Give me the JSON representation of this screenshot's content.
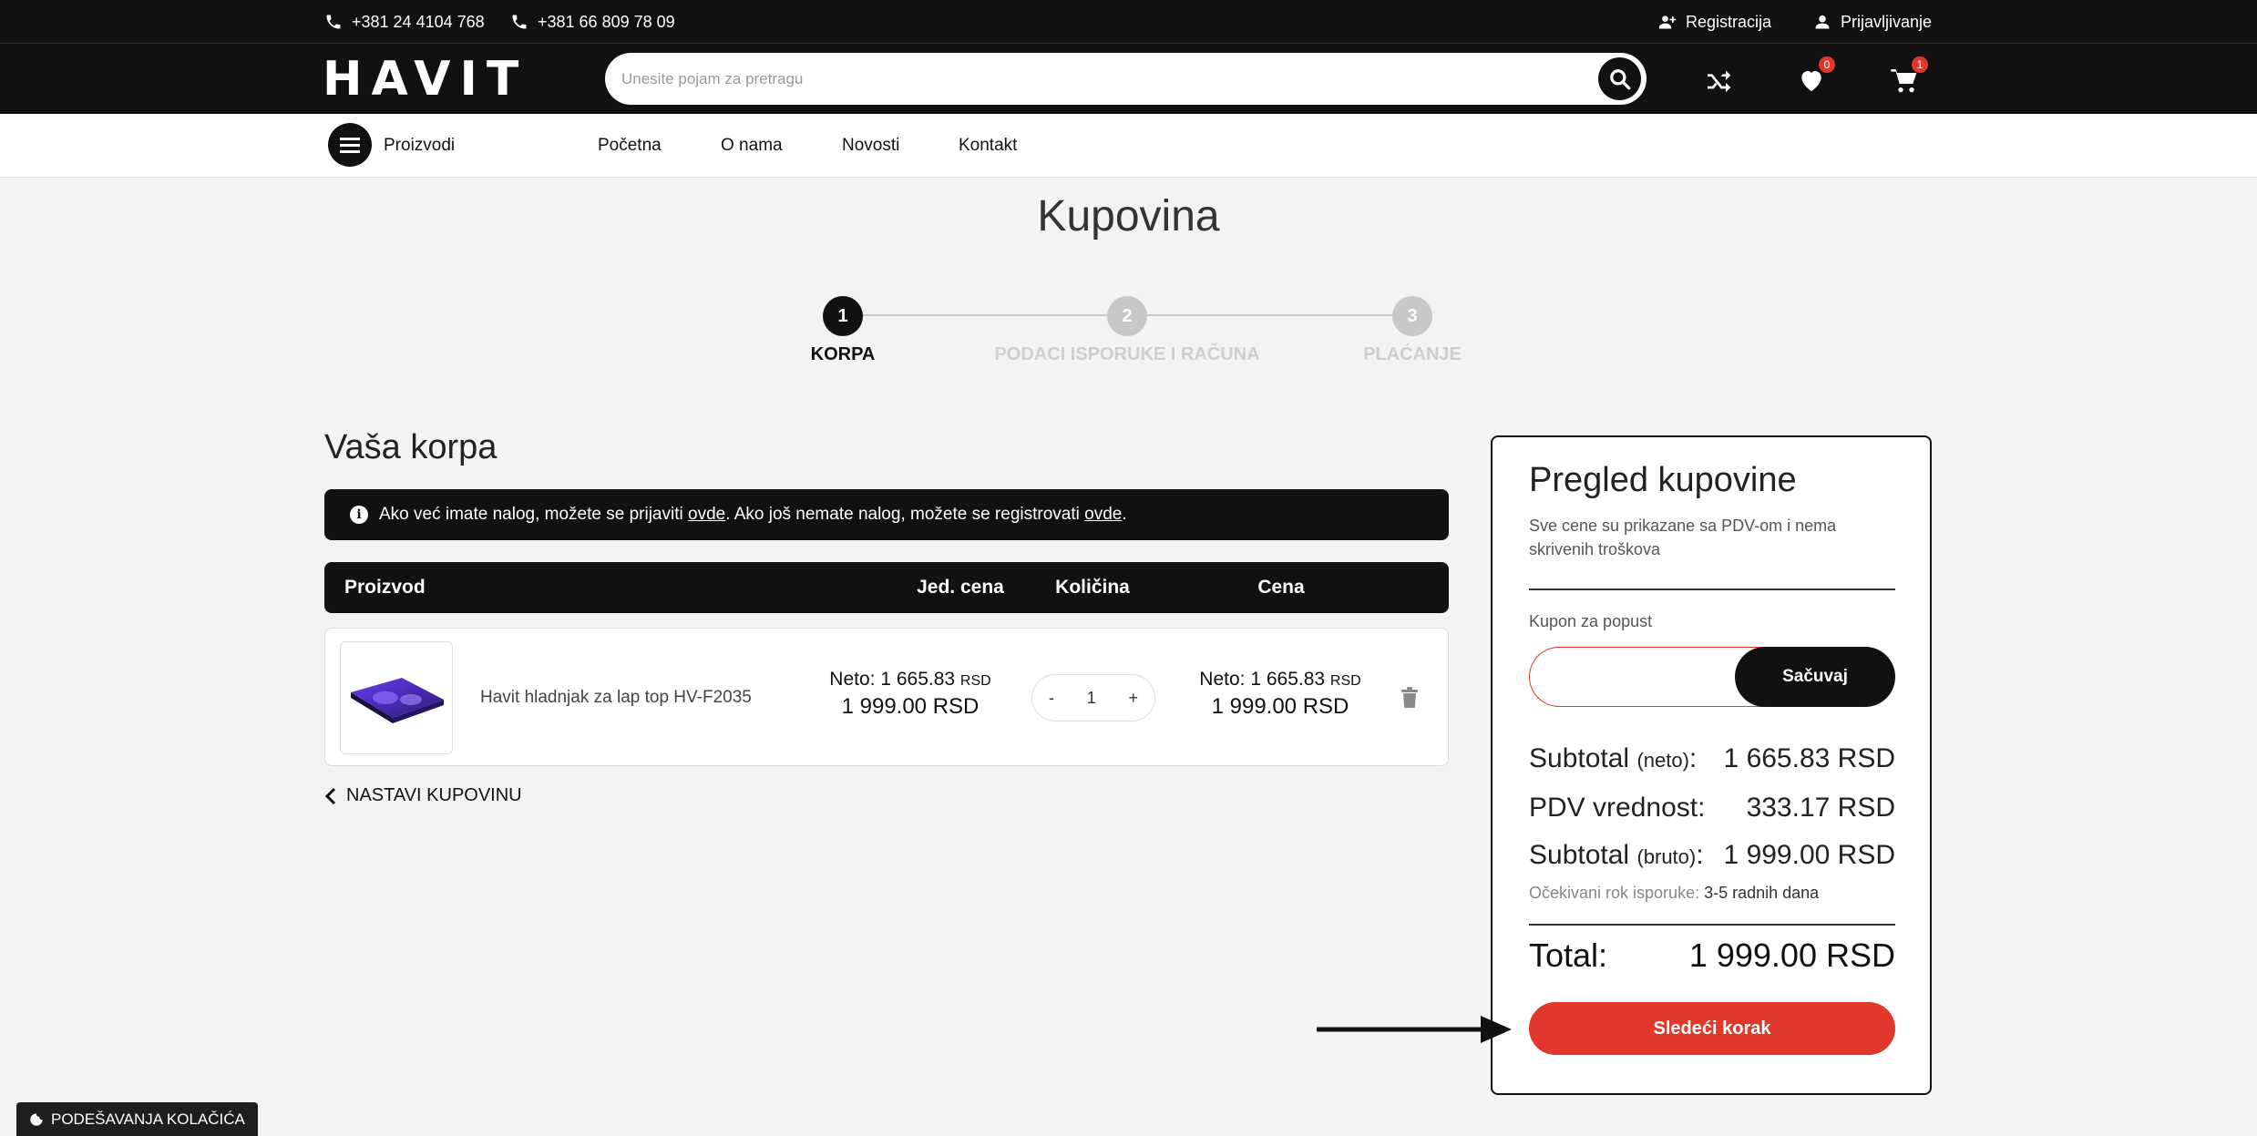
{
  "topbar": {
    "phone1": "+381 24 4104 768",
    "phone2": "+381 66 809 78 09",
    "register": "Registracija",
    "login": "Prijavljivanje"
  },
  "header": {
    "logo": "HAVIT",
    "search_placeholder": "Unesite pojam za pretragu",
    "wishlist_count": "0",
    "cart_count": "1"
  },
  "nav": {
    "products": "Proizvodi",
    "links": [
      "Početna",
      "O nama",
      "Novosti",
      "Kontakt"
    ]
  },
  "page": {
    "title": "Kupovina"
  },
  "steps": [
    {
      "number": "1",
      "label": "KORPA",
      "active": true
    },
    {
      "number": "2",
      "label": "PODACI ISPORUKE I RAČUNA",
      "active": false
    },
    {
      "number": "3",
      "label": "PLAĆANJE",
      "active": false
    }
  ],
  "cart": {
    "title": "Vaša korpa",
    "info_part1": "Ako već imate nalog, možete se prijaviti ",
    "info_link1": "ovde",
    "info_part2": ". Ako još nemate nalog, možete se registrovati ",
    "info_link2": "ovde",
    "info_part3": ".",
    "headers": {
      "product": "Proizvod",
      "unit_price": "Jed. cena",
      "quantity": "Količina",
      "price": "Cena"
    },
    "item": {
      "name": "Havit hladnjak za lap top HV-F2035",
      "unit_neto": "Neto: 1 665.83",
      "unit_neto_currency": "RSD",
      "unit_bruto": "1 999.00 RSD",
      "qty_minus": "-",
      "qty": "1",
      "qty_plus": "+",
      "total_neto": "Neto: 1 665.83",
      "total_neto_currency": "RSD",
      "total_bruto": "1 999.00 RSD"
    },
    "continue": "NASTAVI KUPOVINU"
  },
  "summary": {
    "title": "Pregled kupovine",
    "description": "Sve cene su prikazane sa PDV-om i nema skrivenih troškova",
    "coupon_label": "Kupon za popust",
    "coupon_value": "",
    "coupon_button": "Sačuvaj",
    "subtotal_neto_label": "Subtotal",
    "subtotal_neto_suffix": "(neto)",
    "subtotal_neto_value": "1 665.83 RSD",
    "vat_label": "PDV vrednost:",
    "vat_value": "333.17 RSD",
    "subtotal_bruto_label": "Subtotal",
    "subtotal_bruto_suffix": "(bruto)",
    "subtotal_bruto_value": "1 999.00 RSD",
    "delivery_label": "Očekivani rok isporuke:",
    "delivery_value": "3-5 radnih dana",
    "total_label": "Total:",
    "total_value": "1 999.00 RSD",
    "next_button": "Sledeći korak"
  },
  "cookie": {
    "label": "PODEŠAVANJA KOLAČIĆA"
  },
  "colors": {
    "dark": "#111111",
    "accent_red": "#e0392b",
    "background": "#f3f3f5",
    "inactive_step": "#c8c8c8"
  }
}
